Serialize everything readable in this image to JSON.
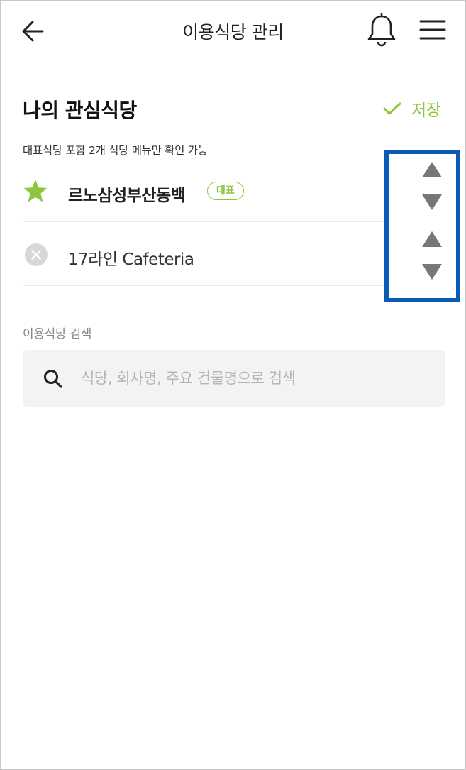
{
  "header": {
    "title": "이용식당 관리",
    "back_icon": "arrow-left-icon",
    "notification_icon": "bell-icon",
    "menu_icon": "hamburger-menu-icon"
  },
  "favorites": {
    "title": "나의 관심식당",
    "save_label": "저장",
    "hint": "대표식당 포함 2개 식당 메뉴만 확인 가능",
    "items": [
      {
        "name": "르노삼성부산동백",
        "badge": "대표",
        "icon": "star-icon"
      },
      {
        "name": "17라인 Cafeteria",
        "icon": "remove-circle-icon"
      }
    ]
  },
  "search": {
    "label": "이용식당 검색",
    "placeholder": "식당, 회사명, 주요 건물명으로 검색",
    "value": ""
  },
  "colors": {
    "accent": "#8cc63f",
    "highlight_border": "#0a5bb5",
    "arrow": "#777777",
    "search_bg": "#f3f3f3"
  }
}
